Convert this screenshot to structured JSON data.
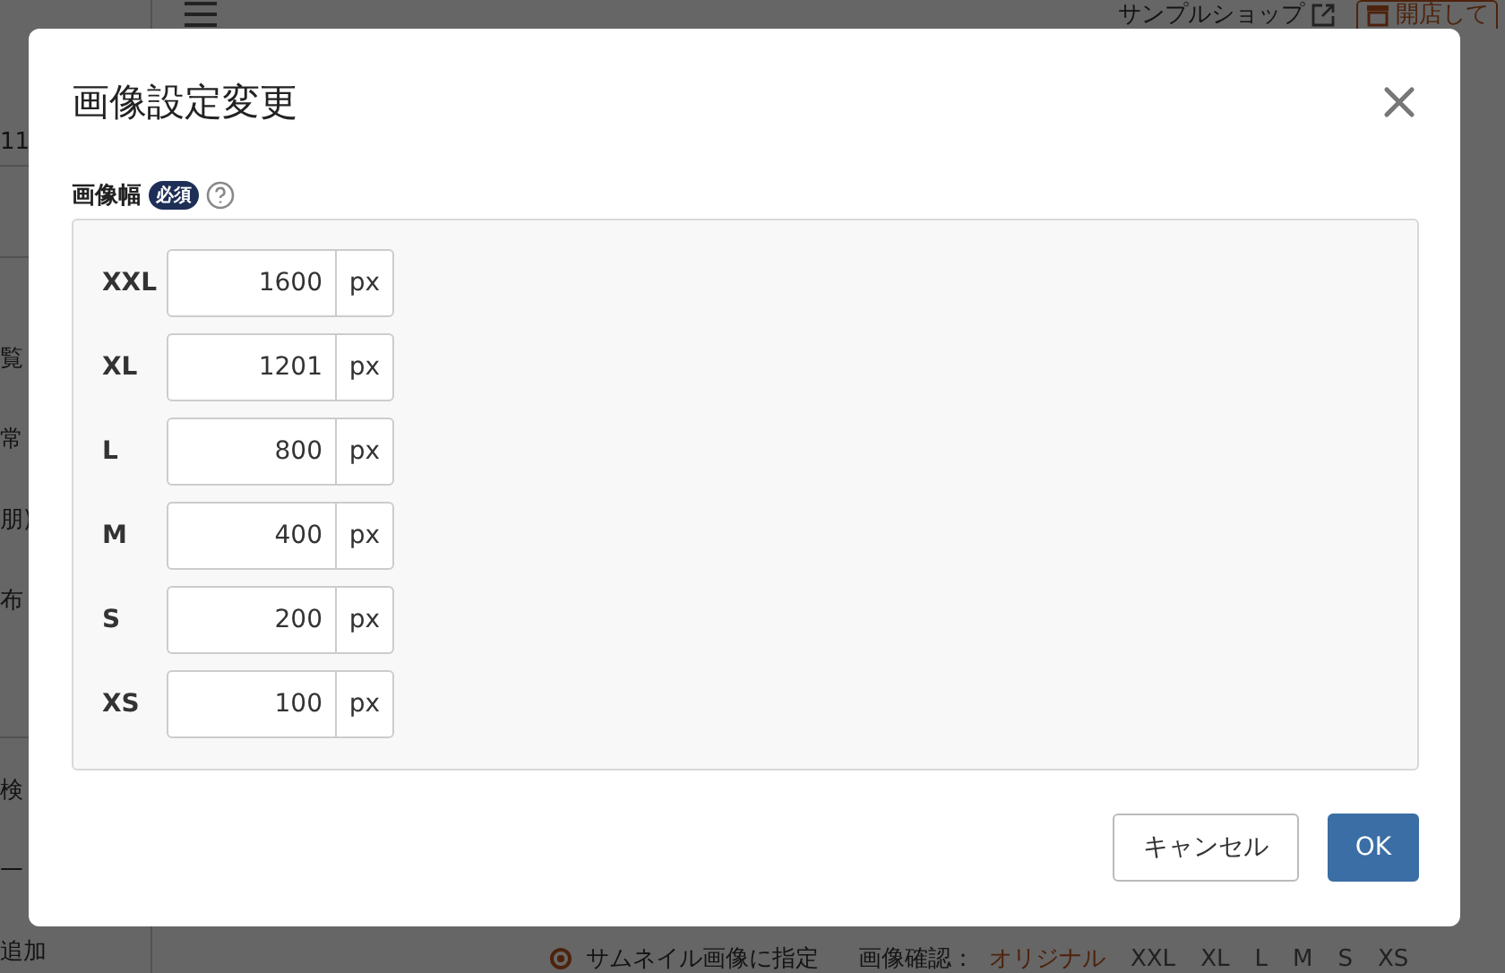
{
  "background": {
    "sidebar_groups": [
      [
        "11"
      ],
      [
        "覧",
        "常",
        "朋)",
        "布"
      ],
      [
        "検",
        "一",
        "追加"
      ]
    ],
    "header": {
      "link": "サンプルショップ",
      "button": "開店して"
    },
    "footer": {
      "radio": {
        "label": "サムネイル画像に指定",
        "selected": true
      },
      "preview_label": "画像確認：",
      "preview_links": [
        "オリジナル",
        "XXL",
        "XL",
        "L",
        "M",
        "S",
        "XS"
      ]
    }
  },
  "dialog": {
    "title": "画像設定変更",
    "field": {
      "label": "画像幅",
      "badge": "必須",
      "rows": [
        {
          "label": "XXL",
          "value": "1600",
          "unit": "px"
        },
        {
          "label": "XL",
          "value": "1201",
          "unit": "px"
        },
        {
          "label": "L",
          "value": "800",
          "unit": "px"
        },
        {
          "label": "M",
          "value": "400",
          "unit": "px"
        },
        {
          "label": "S",
          "value": "200",
          "unit": "px"
        },
        {
          "label": "XS",
          "value": "100",
          "unit": "px"
        }
      ]
    },
    "buttons": [
      {
        "label": "キャンセル",
        "kind": "secondary"
      },
      {
        "label": "OK",
        "kind": "primary"
      }
    ]
  }
}
